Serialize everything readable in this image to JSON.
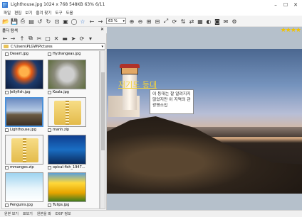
{
  "window": {
    "title": "Lighthouse.jpg   1024 x 768   548KB   63%   6/11",
    "min": "–",
    "max": "☐",
    "close": "✕"
  },
  "menu": [
    "파일",
    "편집",
    "보기",
    "즐겨 찾기",
    "도구",
    "도움"
  ],
  "toolbar": {
    "zoom_value": "63 %",
    "zoom_arrow": "▾"
  },
  "left_panel": {
    "title": "폴더 탐색",
    "close": "✕",
    "path": "C:\\Users\\PLGW\\Pictures"
  },
  "thumbnails": [
    {
      "name": "Desert.jpg",
      "kind": "partial"
    },
    {
      "name": "Hydrangeas.jpg",
      "kind": "partial"
    },
    {
      "name": "Jellyfish.jpg",
      "kind": "jelly"
    },
    {
      "name": "Koala.jpg",
      "kind": "koala"
    },
    {
      "name": "Lighthouse.jpg",
      "kind": "light",
      "selected": true
    },
    {
      "name": "manh.zip",
      "kind": "zip"
    },
    {
      "name": "mmanges.zip",
      "kind": "zip"
    },
    {
      "name": "opical-fish_1947...",
      "kind": "topical"
    },
    {
      "name": "Penguins.jpg",
      "kind": "peng"
    },
    {
      "name": "Tulips.jpg",
      "kind": "tulip"
    }
  ],
  "image": {
    "title": "저기도 등대",
    "note": "이 등대는 잘 알려지지 않았지만 이 지역의 관광명소입",
    "rating": "★★★★"
  },
  "status": [
    "원본 보기",
    "표보기",
    "원본을 봐",
    "EXIF 정보"
  ],
  "colors": {
    "accent": "#4a90d9",
    "title_text": "#f4d23b",
    "star": "#f2c200"
  },
  "icons": [
    "app-icon",
    "open-folder-icon",
    "save-icon",
    "print-icon",
    "film-icon",
    "rotate-left-icon",
    "rotate-right-icon",
    "crop-icon",
    "fullscreen-icon",
    "slideshow-icon",
    "bookmark-icon",
    "back-arrow-icon",
    "forward-arrow-icon",
    "zoom-in-icon",
    "zoom-out-icon",
    "fit-window-icon",
    "actual-size-icon",
    "flip-icon",
    "settings-icon"
  ]
}
